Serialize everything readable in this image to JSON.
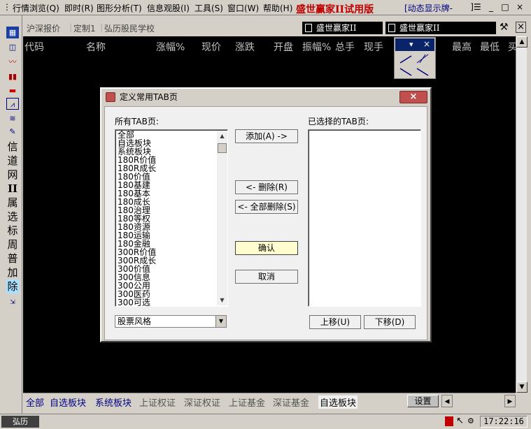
{
  "menu": {
    "items": [
      "行情浏览(Q)",
      "即时(R)",
      "图形分析(T)",
      "信息观股(I)",
      "工具(S)",
      "窗口(W)",
      "帮助(H)"
    ],
    "brand": "盛世赢家II试用版",
    "brand_tail": "[动态显示牌-",
    "win_controls": [
      "]☰",
      "_",
      "□",
      "×"
    ]
  },
  "left_toolbar": {
    "chars": [
      "信",
      "道",
      "网",
      "II",
      "属",
      "选",
      "标",
      "周",
      "普",
      "加",
      "除"
    ]
  },
  "top_tabs": [
    "沪深报价",
    "定制1",
    "弘历股民学校"
  ],
  "indicators": [
    "盛世赢家II",
    "盛世赢家II"
  ],
  "table_headers": [
    "代码",
    "名称",
    "涨幅%",
    "现价",
    "涨跌",
    "开盘",
    "振幅%",
    "总手",
    "现手",
    "最高",
    "最低",
    "买"
  ],
  "bottom_tabs": [
    "全部",
    "自选板块",
    "系统板块",
    "上证权证",
    "深证权证",
    "上证基金",
    "深证基金",
    "自选板块"
  ],
  "setup_label": "设置",
  "status": {
    "left": "弘历",
    "clock": "17:22:16"
  },
  "dialog": {
    "title": "定义常用TAB页",
    "left_label": "所有TAB页:",
    "right_label": "已选择的TAB页:",
    "list_items": [
      "全部",
      "自选板块",
      "系统板块",
      "180R价值",
      "180R成长",
      "180价值",
      "180基建",
      "180基本",
      "180成长",
      "180治理",
      "180等权",
      "180资源",
      "180运输",
      "180金融",
      "300R价值",
      "300R成长",
      "300价值",
      "300信息",
      "300公用",
      "300医药",
      "300可选"
    ],
    "buttons": {
      "add": "添加(A) ->",
      "remove": "<- 删除(R)",
      "remove_all": "<- 全部删除(S)",
      "ok": "确认",
      "cancel": "取消",
      "up": "上移(U)",
      "down": "下移(D)"
    },
    "combo_value": "股票风格",
    "close": "×"
  }
}
